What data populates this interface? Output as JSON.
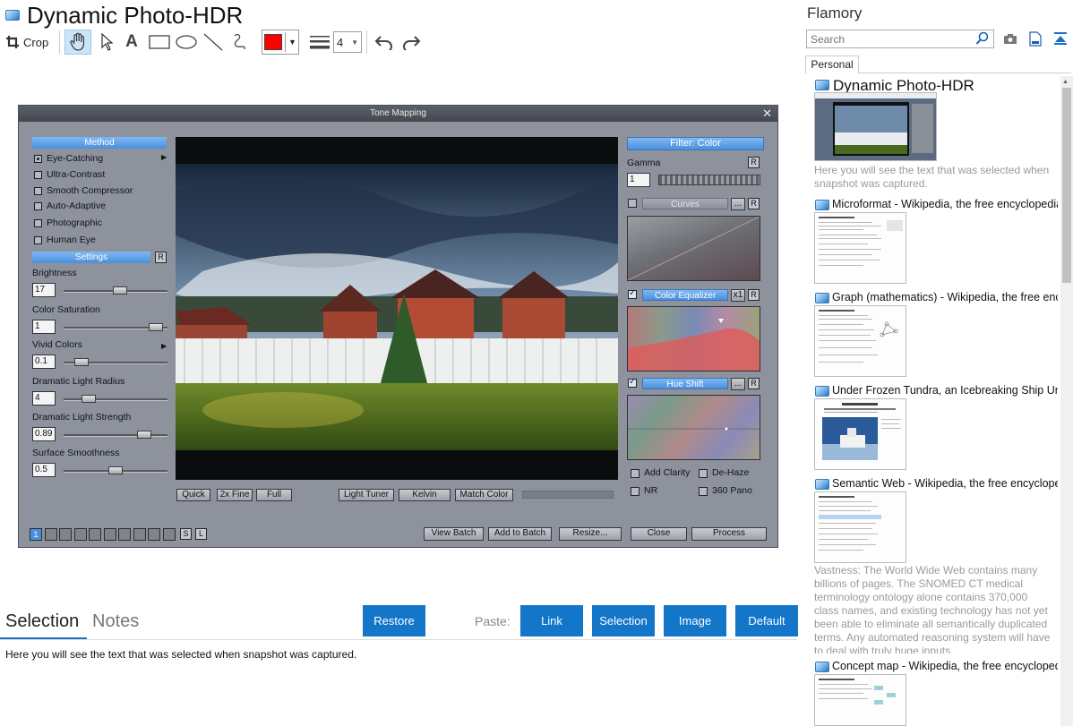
{
  "window": {
    "title": "Dynamic Photo-HDR"
  },
  "toolbar": {
    "crop_label": "Crop",
    "line_width": "4",
    "color": "#ff0000"
  },
  "dialog": {
    "title": "Tone Mapping",
    "method_header": "Method",
    "methods": [
      "Eye-Catching",
      "Ultra-Contrast",
      "Smooth Compressor",
      "Auto-Adaptive",
      "Photographic",
      "Human Eye"
    ],
    "selected_method": "Eye-Catching",
    "settings_header": "Settings",
    "settings": [
      {
        "label": "Brightness",
        "value": "17",
        "level": 0.55
      },
      {
        "label": "Color Saturation",
        "value": "1",
        "level": 0.95
      },
      {
        "label": "Vivid Colors",
        "value": "0.1",
        "level": 0.12
      },
      {
        "label": "Dramatic Light Radius",
        "value": "4",
        "level": 0.2
      },
      {
        "label": "Dramatic Light Strength",
        "value": "0.89",
        "level": 0.82
      },
      {
        "label": "Surface Smoothness",
        "value": "0.5",
        "level": 0.5
      }
    ],
    "filter_header": "Filter: Color",
    "gamma_label": "Gamma",
    "gamma_value": "1",
    "curves_label": "Curves",
    "color_equalizer_label": "Color Equalizer",
    "x1_label": "x1",
    "hue_shift_label": "Hue Shift",
    "ellipsis": "...",
    "r_label": "R",
    "checks": {
      "add_clarity": "Add Clarity",
      "de_haze": "De-Haze",
      "nr": "NR",
      "pano": "360 Pano"
    },
    "view_buttons": {
      "quick": "Quick",
      "fine": "2x Fine",
      "full": "Full",
      "light_tuner": "Light Tuner",
      "kelvin": "Kelvin",
      "match_color": "Match Color"
    },
    "slots": [
      "1",
      "",
      "",
      "",
      "",
      "",
      "",
      "",
      "",
      ""
    ],
    "s_label": "S",
    "l_label": "L",
    "bottom_buttons": {
      "view_batch": "View Batch",
      "add_to_batch": "Add to Batch",
      "resize": "Resize...",
      "close": "Close",
      "process": "Process"
    }
  },
  "flamory": {
    "title": "Flamory",
    "search_placeholder": "Search",
    "tab": "Personal",
    "items": [
      {
        "title": "Dynamic Photo-HDR",
        "snippet": "Here you will see the text that was selected when snapshot was captured."
      },
      {
        "title": "Microformat - Wikipedia, the free encyclopedia"
      },
      {
        "title": "Graph (mathematics) - Wikipedia, the free ency"
      },
      {
        "title": "Under Frozen Tundra, an Icebreaking Ship Unco"
      },
      {
        "title": "Semantic Web - Wikipedia, the free encycloped",
        "snippet": "Vastness: The World Wide Web contains many billions of pages. The SNOMED CT medical terminology ontology alone contains 370,000 class names, and existing technology has not yet been able to eliminate all semantically duplicated terms. Any automated reasoning system will have to deal with truly huge inputs."
      },
      {
        "title": "Concept map - Wikipedia, the free encyclopedi"
      }
    ]
  },
  "bottom": {
    "tab_selection": "Selection",
    "tab_notes": "Notes",
    "restore": "Restore",
    "paste_label": "Paste:",
    "paste_buttons": [
      "Link",
      "Selection",
      "Image",
      "Default"
    ],
    "selection_text": "Here you will see the text that was selected when snapshot was captured."
  }
}
